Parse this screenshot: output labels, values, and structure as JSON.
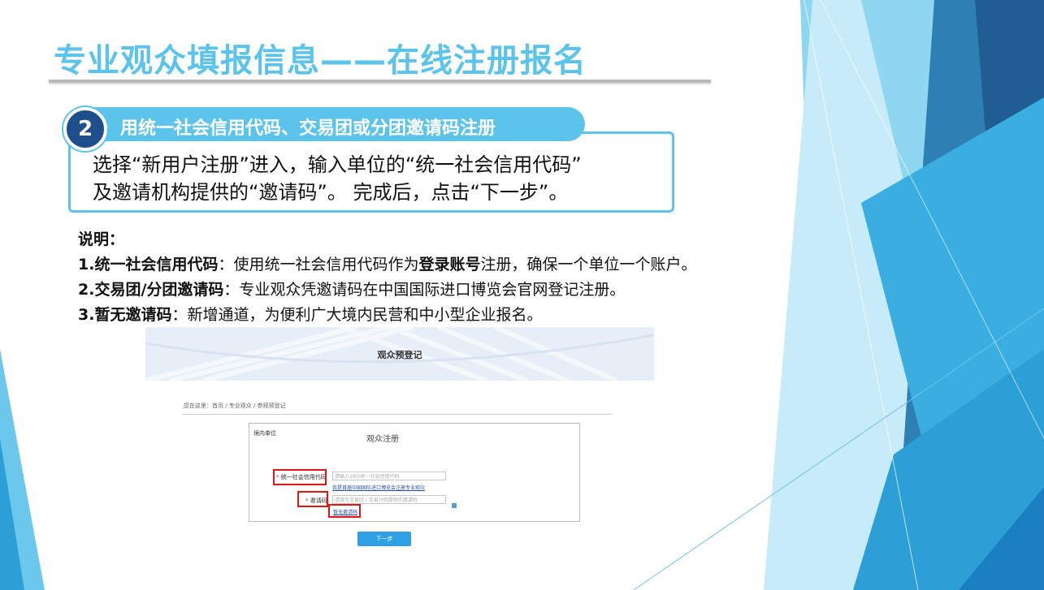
{
  "slide": {
    "title": "专业观众填报信息——在线注册报名",
    "step": {
      "number": "2",
      "heading": "用统一社会信用代码、交易团或分团邀请码注册",
      "description_line1": "选择“新用户注册”进入，输入单位的“统一社会信用代码”",
      "description_line2": "及邀请机构提供的“邀请码”。 完成后，点击“下一步”。"
    },
    "notes": {
      "heading": "说明：",
      "items": [
        {
          "term": "1.统一社会信用代码",
          "text_a": "：使用统一社会信用代码作为",
          "emph": "登录账号",
          "text_b": "注册，确保一个单位一个账户。"
        },
        {
          "term": "2.交易团/分团邀请码",
          "text_a": "：专业观众凭邀请码在中国国际进口博览会官网登记注册。",
          "emph": "",
          "text_b": ""
        },
        {
          "term": "3.暂无邀请码",
          "text_a": "：新增通道，为便利广大境内民营和中小型企业报名。",
          "emph": "",
          "text_b": ""
        }
      ]
    }
  },
  "screenshot": {
    "banner_title": "观众预登记",
    "breadcrumb": "您在这里：首页 / 专业观众 / 参观预登记",
    "panel_tag": "境内单位",
    "panel_title": "观众注册",
    "credit_code": {
      "label": "统一社会信用代码",
      "placeholder": "请输入18位统一社会信用代码",
      "link": "我是首届中国国际进口博览会注册专业观众"
    },
    "invite_code": {
      "label": "邀请码",
      "placeholder": "请填写交易团 / 交易分团提供的邀请码",
      "link": "暂无邀请码"
    },
    "next_button": "下一步"
  },
  "colors": {
    "accent": "#5cc3ea",
    "step_circle": "#1f4e8c",
    "highlight": "#e01515",
    "button": "#2ea0e3"
  }
}
